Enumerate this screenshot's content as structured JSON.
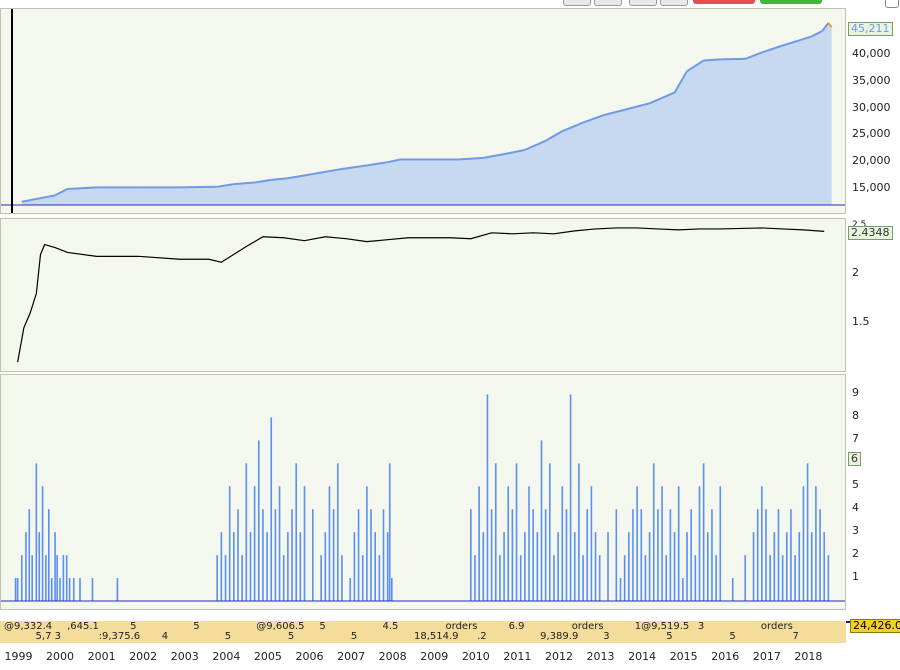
{
  "chart_data": [
    {
      "type": "area",
      "panel": "equity",
      "ylim": [
        12000,
        47500
      ],
      "yticks": [
        "15,000",
        "20,000",
        "25,000",
        "30,000",
        "35,000",
        "40,000"
      ],
      "ytick_values": [
        15000,
        20000,
        25000,
        30000,
        35000,
        40000
      ],
      "last_value_label": "45,211",
      "x_years": [
        1999.2,
        1999.6,
        2000.0,
        2000.3,
        2001,
        2002,
        2003,
        2003.9,
        2004.3,
        2004.8,
        2005.2,
        2005.6,
        2006.2,
        2006.8,
        2007.5,
        2008.0,
        2008.3,
        2009.0,
        2009.7,
        2010.3,
        2010.8,
        2011.3,
        2011.8,
        2012.2,
        2012.7,
        2013.2,
        2013.7,
        2014.3,
        2014.9,
        2015.2,
        2015.6,
        2016.0,
        2016.6,
        2017.0,
        2017.5,
        2018.0,
        2018.2,
        2018.45,
        2018.6,
        2018.68
      ],
      "values": [
        12600,
        13200,
        13800,
        15000,
        15300,
        15300,
        15300,
        15400,
        15900,
        16200,
        16700,
        17000,
        17800,
        18600,
        19400,
        20000,
        20500,
        20500,
        20500,
        20800,
        21500,
        22300,
        24000,
        25800,
        27400,
        28800,
        29800,
        31000,
        33000,
        37000,
        39000,
        39200,
        39300,
        40500,
        41800,
        43000,
        43500,
        44500,
        46000,
        45211
      ]
    },
    {
      "type": "line",
      "panel": "ratio",
      "ylim": [
        1.05,
        2.5
      ],
      "yticks": [
        "1.5",
        "2"
      ],
      "ytick_values": [
        1.5,
        2
      ],
      "top_tick_label": "2.5",
      "last_value_label": "2.4348",
      "x_years": [
        1999.1,
        1999.25,
        1999.4,
        1999.55,
        1999.65,
        1999.75,
        2000.0,
        2000.3,
        2001.0,
        2002.0,
        2003.0,
        2003.7,
        2004.0,
        2004.3,
        2004.6,
        2005.0,
        2005.5,
        2006.0,
        2006.5,
        2007.0,
        2007.5,
        2008.0,
        2008.5,
        2009.5,
        2010.0,
        2010.5,
        2011.0,
        2011.5,
        2012.0,
        2012.5,
        2013.0,
        2013.5,
        2014.0,
        2014.5,
        2015.0,
        2015.5,
        2016.0,
        2017.0,
        2017.5,
        2018.0,
        2018.5
      ],
      "values": [
        1.1,
        1.45,
        1.6,
        1.8,
        2.2,
        2.3,
        2.27,
        2.22,
        2.18,
        2.18,
        2.15,
        2.15,
        2.12,
        2.2,
        2.28,
        2.38,
        2.37,
        2.34,
        2.38,
        2.36,
        2.33,
        2.35,
        2.37,
        2.37,
        2.36,
        2.42,
        2.41,
        2.42,
        2.41,
        2.44,
        2.46,
        2.47,
        2.47,
        2.46,
        2.45,
        2.46,
        2.46,
        2.47,
        2.46,
        2.45,
        2.4348
      ]
    },
    {
      "type": "bar",
      "panel": "positions",
      "ylim": [
        0,
        9.5
      ],
      "yticks": [
        "1",
        "2",
        "3",
        "4",
        "5",
        "6",
        "7",
        "8",
        "9"
      ],
      "ytick_values": [
        1,
        2,
        3,
        4,
        5,
        6,
        7,
        8,
        9
      ],
      "last_value_label": "6",
      "x_years": [
        1999.05,
        1999.1,
        1999.2,
        1999.3,
        1999.38,
        1999.45,
        1999.55,
        1999.62,
        1999.7,
        1999.78,
        1999.85,
        1999.92,
        2000.0,
        2000.05,
        2000.12,
        2000.2,
        2000.28,
        2000.35,
        2000.45,
        2000.6,
        2000.9,
        2001.5,
        2003.9,
        2004.0,
        2004.1,
        2004.2,
        2004.3,
        2004.4,
        2004.5,
        2004.6,
        2004.7,
        2004.8,
        2004.9,
        2005.0,
        2005.1,
        2005.2,
        2005.3,
        2005.4,
        2005.5,
        2005.6,
        2005.7,
        2005.8,
        2005.9,
        2006.0,
        2006.2,
        2006.4,
        2006.5,
        2006.6,
        2006.7,
        2006.8,
        2006.9,
        2007.1,
        2007.2,
        2007.3,
        2007.4,
        2007.5,
        2007.6,
        2007.7,
        2007.8,
        2007.9,
        2008.0,
        2008.05,
        2008.1,
        2010.0,
        2010.1,
        2010.2,
        2010.3,
        2010.4,
        2010.5,
        2010.6,
        2010.7,
        2010.8,
        2010.9,
        2011.0,
        2011.1,
        2011.2,
        2011.3,
        2011.4,
        2011.5,
        2011.6,
        2011.7,
        2011.8,
        2011.9,
        2012.0,
        2012.1,
        2012.2,
        2012.3,
        2012.4,
        2012.5,
        2012.6,
        2012.7,
        2012.8,
        2012.9,
        2013.0,
        2013.1,
        2013.3,
        2013.5,
        2013.6,
        2013.7,
        2013.8,
        2013.9,
        2014.0,
        2014.1,
        2014.2,
        2014.3,
        2014.4,
        2014.5,
        2014.6,
        2014.7,
        2014.8,
        2014.9,
        2015.0,
        2015.1,
        2015.2,
        2015.3,
        2015.4,
        2015.5,
        2015.6,
        2015.7,
        2015.8,
        2015.9,
        2016.0,
        2016.3,
        2016.6,
        2016.8,
        2016.9,
        2017.0,
        2017.1,
        2017.2,
        2017.3,
        2017.4,
        2017.5,
        2017.6,
        2017.7,
        2017.8,
        2017.9,
        2018.0,
        2018.1,
        2018.2,
        2018.3,
        2018.4,
        2018.5,
        2018.6
      ],
      "values": [
        1,
        1,
        2,
        3,
        4,
        2,
        6,
        3,
        5,
        2,
        4,
        1,
        3,
        2,
        1,
        2,
        2,
        1,
        1,
        1,
        1,
        1,
        2,
        3,
        2,
        5,
        3,
        4,
        2,
        6,
        3,
        5,
        7,
        4,
        3,
        8,
        4,
        5,
        2,
        3,
        4,
        6,
        3,
        5,
        4,
        2,
        3,
        5,
        4,
        6,
        2,
        1,
        3,
        4,
        2,
        5,
        4,
        3,
        2,
        4,
        3,
        6,
        1,
        4,
        2,
        5,
        3,
        9,
        4,
        6,
        2,
        3,
        5,
        4,
        6,
        2,
        3,
        5,
        4,
        3,
        7,
        4,
        6,
        2,
        3,
        5,
        4,
        9,
        3,
        6,
        2,
        4,
        5,
        3,
        2,
        3,
        4,
        1,
        2,
        3,
        4,
        5,
        4,
        2,
        3,
        6,
        4,
        5,
        2,
        4,
        3,
        5,
        1,
        3,
        4,
        2,
        5,
        6,
        3,
        4,
        2,
        5,
        1,
        2,
        3,
        4,
        5,
        4,
        2,
        3,
        4,
        2,
        3,
        4,
        2,
        3,
        5,
        6,
        3,
        5,
        4,
        3,
        2,
        5,
        6
      ],
      "note": ""
    }
  ],
  "x_axis": {
    "year_labels": [
      "1999",
      "2000",
      "2001",
      "2002",
      "2003",
      "2004",
      "2005",
      "2006",
      "2007",
      "2008",
      "2009",
      "2010",
      "2011",
      "2012",
      "2013",
      "2014",
      "2015",
      "2016",
      "2017",
      "2018"
    ],
    "year_values": [
      1999,
      2000,
      2001,
      2002,
      2003,
      2004,
      2005,
      2006,
      2007,
      2008,
      2009,
      2010,
      2011,
      2012,
      2013,
      2014,
      2015,
      2016,
      2017,
      2018
    ],
    "x_range": [
      1998.7,
      2019.0
    ]
  },
  "trade_strip": {
    "right_value": "24,426.0",
    "fragments": [
      "@9,332.4",
      "5,7 3",
      ",645.1",
      ":9,375.6",
      "5",
      "4",
      "5",
      "5",
      "@9,606.5",
      "5",
      "5",
      "5",
      "4.5",
      "18,514.9",
      "orders",
      ".2",
      "6.9",
      "9,389.9",
      "orders",
      "3",
      "1@9,519.5",
      "5",
      "3",
      "5",
      "orders",
      "7"
    ]
  },
  "colors": {
    "equity_fill": "#c6d9f1",
    "equity_up": "#6f9be4",
    "equity_down": "#f3a032",
    "ratio_line": "#000000",
    "bars": "#5b8ff0",
    "baseline": "#2a2ab0",
    "panel_bg": "#f3f7ee",
    "strip_bg": "#f4dc9a"
  }
}
